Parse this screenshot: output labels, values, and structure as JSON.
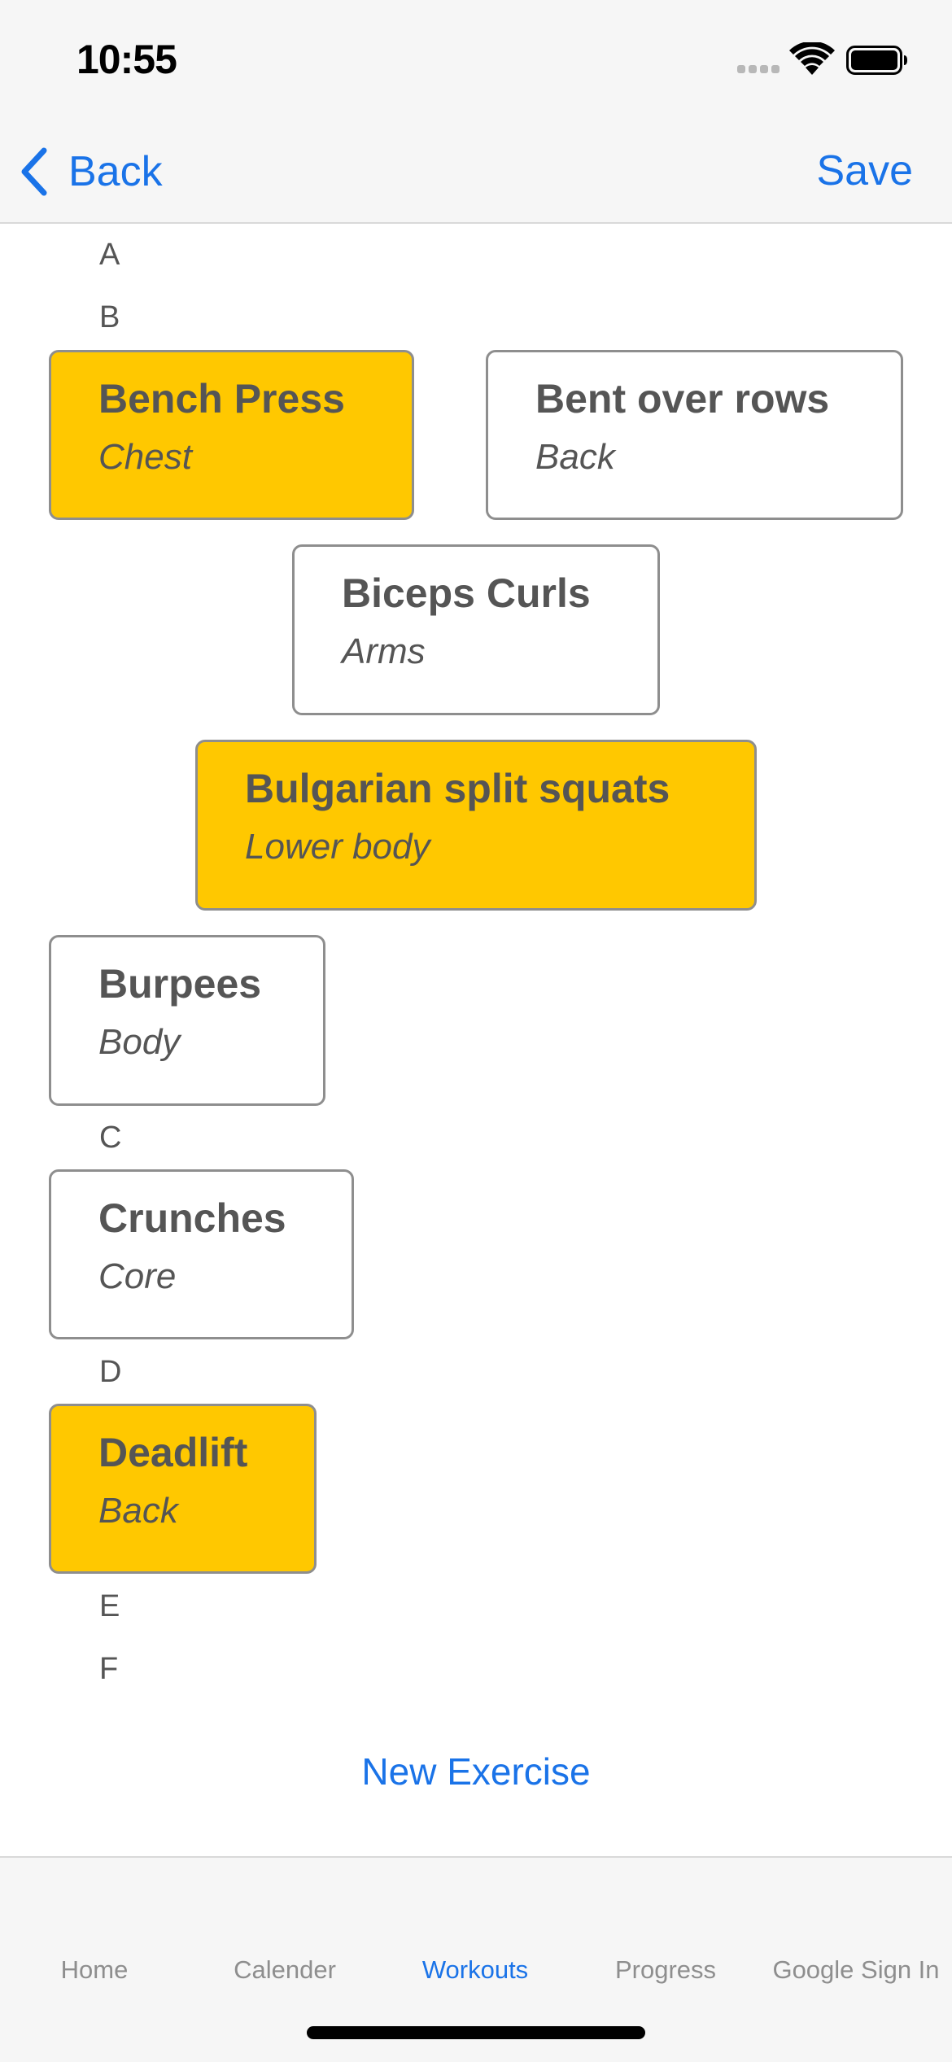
{
  "status_bar": {
    "time": "10:55",
    "icons": [
      "signal-icon",
      "wifi-icon",
      "battery-icon"
    ]
  },
  "nav": {
    "back_label": "Back",
    "back_icon": "chevron-left-icon",
    "save_label": "Save"
  },
  "sections": [
    {
      "letter": "A",
      "exercises": []
    },
    {
      "letter": "B",
      "exercises": [
        {
          "name": "Bench Press",
          "category": "Chest",
          "selected": true
        },
        {
          "name": "Bent over rows",
          "category": "Back",
          "selected": false
        },
        {
          "name": "Biceps Curls",
          "category": "Arms",
          "selected": false
        },
        {
          "name": "Bulgarian split squats",
          "category": "Lower body",
          "selected": true
        },
        {
          "name": "Burpees",
          "category": "Body",
          "selected": false
        }
      ]
    },
    {
      "letter": "C",
      "exercises": [
        {
          "name": "Crunches",
          "category": "Core",
          "selected": false
        }
      ]
    },
    {
      "letter": "D",
      "exercises": [
        {
          "name": "Deadlift",
          "category": "Back",
          "selected": true
        }
      ]
    },
    {
      "letter": "E",
      "exercises": []
    },
    {
      "letter": "F",
      "exercises": []
    }
  ],
  "new_exercise_label": "New Exercise",
  "tabs": [
    {
      "label": "Home",
      "active": false
    },
    {
      "label": "Calender",
      "active": false
    },
    {
      "label": "Workouts",
      "active": true
    },
    {
      "label": "Progress",
      "active": false
    },
    {
      "label": "Google Sign In",
      "active": false
    }
  ],
  "colors": {
    "accent": "#1a73e8",
    "selected_card": "#ffc800",
    "text": "#555555",
    "bar_background": "#f6f6f6"
  }
}
